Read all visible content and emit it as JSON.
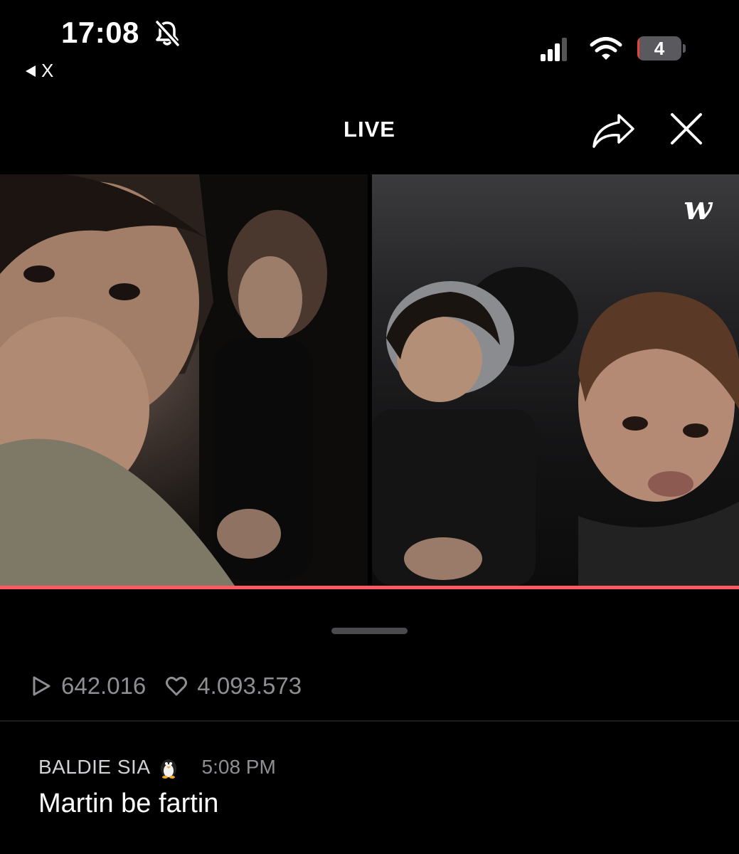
{
  "status_bar": {
    "time": "17:08",
    "back_label": "X",
    "battery_level": "4"
  },
  "header": {
    "title": "LIVE"
  },
  "video": {
    "brand_logo": "w",
    "progress_fraction": 1.0,
    "accent_color": "#ff5a5f"
  },
  "stats": {
    "views": "642.016",
    "likes": "4.093.573"
  },
  "comment": {
    "author": "BALDIE SIA",
    "time": "5:08 PM",
    "text": "Martin be fartin"
  }
}
